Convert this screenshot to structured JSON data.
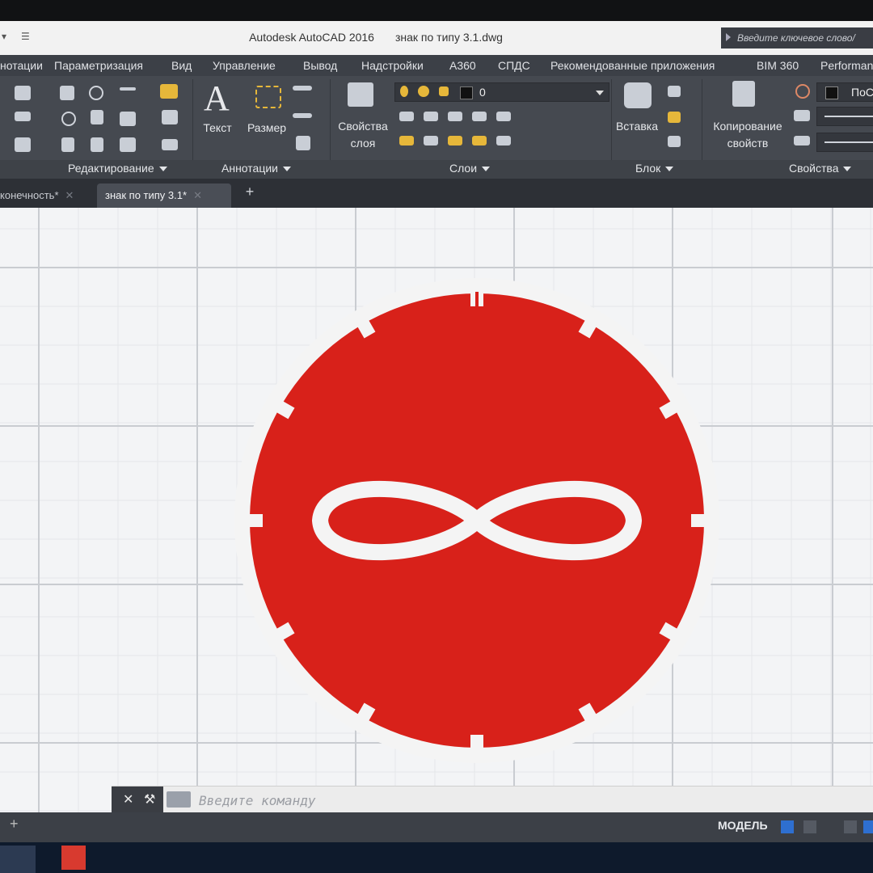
{
  "title_bar": {
    "app_title": "Autodesk AutoCAD 2016",
    "file_name": "знак по типу 3.1.dwg",
    "search_placeholder": "Введите ключевое слово/"
  },
  "menu_tabs": [
    "нотации",
    "Параметризация",
    "Вид",
    "Управление",
    "Вывод",
    "Надстройки",
    "A360",
    "СПДС",
    "Рекомендованные приложения",
    "BIM 360",
    "Performan"
  ],
  "ribbon": {
    "panels": {
      "edit": "Редактирование",
      "annotations": "Аннотации",
      "layers": "Слои",
      "block": "Блок",
      "properties": "Свойства"
    },
    "buttons": {
      "text": "Текст",
      "dimension": "Размер",
      "layer_props_1": "Свойства",
      "layer_props_2": "слоя",
      "insert": "Вставка",
      "copy_props_1": "Копирование",
      "copy_props_2": "свойств"
    },
    "layer_current": "0",
    "properties_combo": "ПоС"
  },
  "doc_tabs": [
    {
      "label": "конечность*",
      "active": false
    },
    {
      "label": "знак по типу 3.1*",
      "active": true
    }
  ],
  "command_line": {
    "placeholder": "Введите команду"
  },
  "status_bar": {
    "model": "МОДЕЛЬ"
  },
  "drawing": {
    "sign_fill": "#d8211a",
    "sign_ring": "#f4f4f4",
    "grid_color": "#c9ccd1",
    "symbol": "infinity"
  }
}
